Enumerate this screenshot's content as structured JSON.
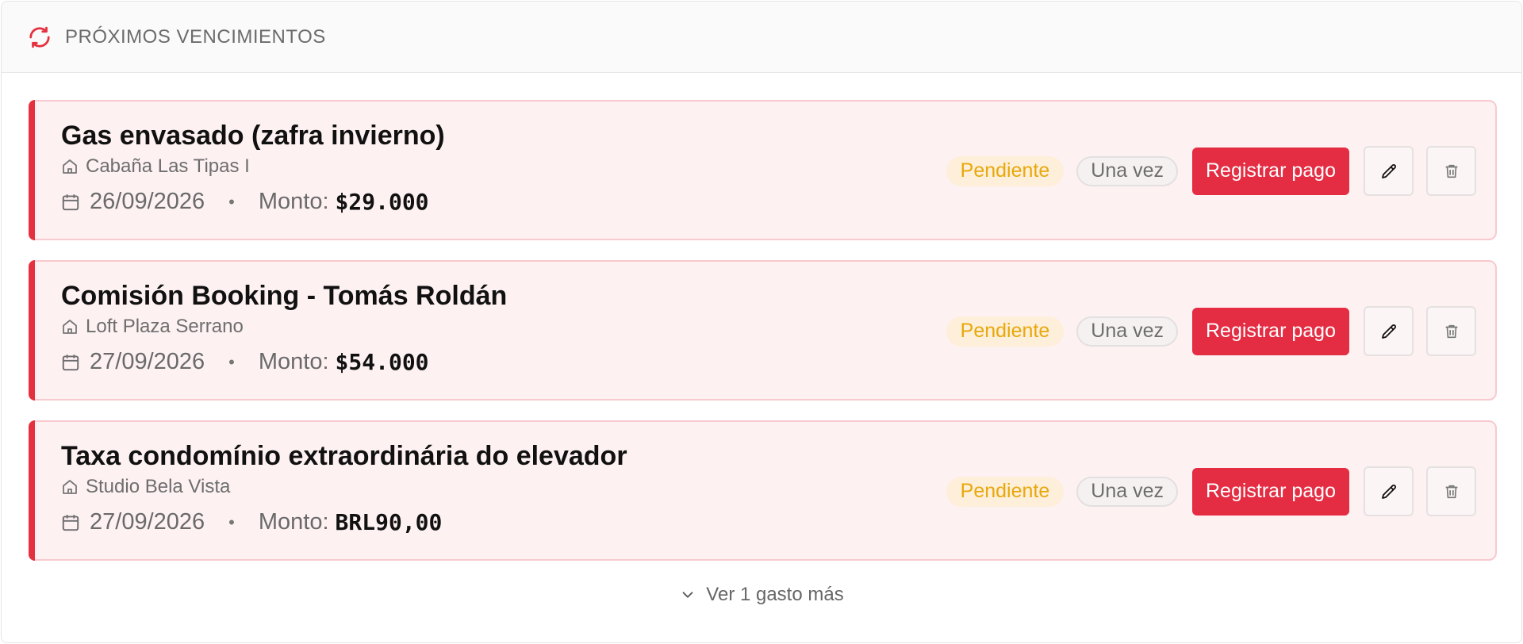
{
  "header": {
    "title": "PRÓXIMOS VENCIMIENTOS",
    "icon": "refresh-icon",
    "accent_color": "#e5303f"
  },
  "expenses": [
    {
      "title": "Gas envasado (zafra invierno)",
      "property": "Cabaña Las Tipas I",
      "date": "26/09/2026",
      "amount_label": "Monto:",
      "amount": "$29.000",
      "status": "Pendiente",
      "frequency": "Una vez",
      "pay_label": "Registrar pago"
    },
    {
      "title": "Comisión Booking - Tomás Roldán",
      "property": "Loft Plaza Serrano",
      "date": "27/09/2026",
      "amount_label": "Monto:",
      "amount": "$54.000",
      "status": "Pendiente",
      "frequency": "Una vez",
      "pay_label": "Registrar pago"
    },
    {
      "title": "Taxa condomínio extraordinária do elevador",
      "property": "Studio Bela Vista",
      "date": "27/09/2026",
      "amount_label": "Monto:",
      "amount": "BRL90,00",
      "status": "Pendiente",
      "frequency": "Una vez",
      "pay_label": "Registrar pago"
    }
  ],
  "footer": {
    "more_label": "Ver 1 gasto más",
    "icon": "chevron-down-icon"
  },
  "colors": {
    "card_bg": "#fdf1f2",
    "card_border": "#f8c9cf",
    "pay_button": "#e42c42",
    "pending_text": "#e8a80c",
    "pending_bg": "#fdefd9"
  }
}
